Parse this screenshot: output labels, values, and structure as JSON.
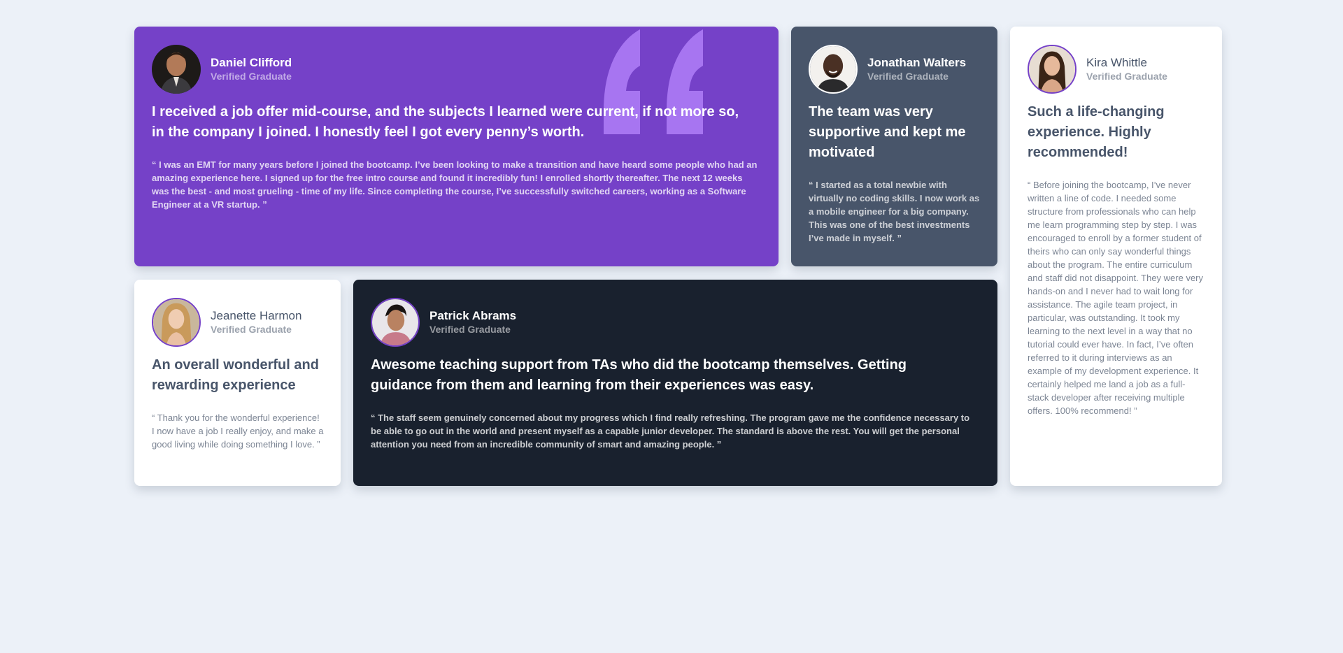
{
  "testimonials": [
    {
      "name": "Daniel Clifford",
      "role": "Verified Graduate",
      "headline": "I received a job offer mid-course, and the subjects I learned were current, if not more so, in the company I joined. I honestly feel I got every penny’s worth.",
      "body": "“ I was an EMT for many years before I joined the bootcamp. I’ve been looking to make a transition and have heard some people who had an amazing experience here. I signed up for the free intro course and found it incredibly fun! I enrolled shortly thereafter. The next 12 weeks was the best - and most grueling - time of my life. Since completing the course, I’ve successfully switched careers, working as a Software Engineer at a VR startup. ”",
      "card_color": "#7541c8"
    },
    {
      "name": "Jonathan Walters",
      "role": "Verified Graduate",
      "headline": "The team was very supportive and kept me motivated",
      "body": "“ I started as a total newbie with virtually no coding skills. I now work as a mobile engineer for a big company. This was one of the best investments I’ve made in myself. ”",
      "card_color": "#48556a"
    },
    {
      "name": "Kira Whittle",
      "role": "Verified Graduate",
      "headline": "Such a life-changing experience. Highly recommended!",
      "body": "“ Before joining the bootcamp, I’ve never written a line of code. I needed some structure from professionals who can help me learn programming step by step. I was encouraged to enroll by a former student of theirs who can only say wonderful things about the program. The entire curriculum and staff did not disappoint. They were very hands-on and I never had to wait long for assistance. The agile team project, in particular, was outstanding. It took my learning to the next level in a way that no tutorial could ever have. In fact, I’ve often referred to it during interviews as an example of my development experience. It certainly helped me land a job as a full-stack developer after receiving multiple offers. 100% recommend! ”",
      "card_color": "#ffffff"
    },
    {
      "name": "Jeanette Harmon",
      "role": "Verified Graduate",
      "headline": "An overall wonderful and rewarding experience",
      "body": "“ Thank you for the wonderful experience! I now have a job I really enjoy, and make a good living while doing something I love. ”",
      "card_color": "#ffffff"
    },
    {
      "name": "Patrick Abrams",
      "role": "Verified Graduate",
      "headline": "Awesome teaching support from TAs who did the bootcamp themselves. Getting guidance from them and learning from their experiences was easy.",
      "body": "“ The staff seem genuinely concerned about my progress which I find really refreshing. The program gave me the confidence necessary to be able to go out in the world and present myself as a capable junior developer. The standard is above the rest. You will get the personal attention you need from an incredible community of smart and amazing people. ”",
      "card_color": "#19212e"
    }
  ],
  "colors": {
    "page_background": "#ecf1f8",
    "moderate_violet": "#7541c8",
    "quote_mark": "#a775f1",
    "grayish_blue": "#48556a",
    "dark_blackish_blue": "#19212e",
    "white": "#ffffff"
  },
  "icons": {
    "quote": "quotation-mark-icon"
  }
}
